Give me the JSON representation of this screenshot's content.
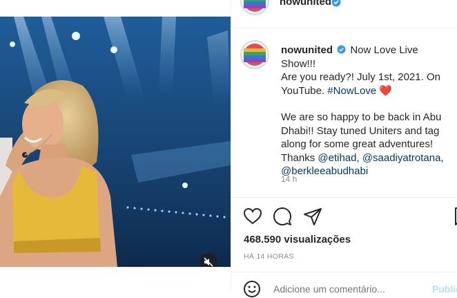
{
  "post": {
    "username": "nowunited",
    "caption_lines": [
      "Now Love Live Show!!!",
      "Are you ready?! July 1st, 2021. On",
      "YouTube."
    ],
    "hashtag": "#NowLove",
    "heart_emoji": "❤️",
    "paragraph2_lines": [
      "We are so happy to be back in Abu",
      "Dhabi!! Stay tuned Uniters and tag",
      "along for some great adventures!"
    ],
    "thanks_text": "Thanks",
    "mentions": [
      "@etihad,",
      "@saadiyatrotana,",
      "@berkleeabudhabi"
    ],
    "caption_time": "14 h",
    "views": "468.590 visualizações",
    "posted_ago": "HÁ 14 HORAS",
    "comment_placeholder": "Adicione um comentário...",
    "publish_label": "Publicar"
  },
  "colors": {
    "verified": "#3897f0",
    "link": "#00376b",
    "heart": "#ed4956",
    "muted": "#8e8e8e",
    "publish": "#b2dffc",
    "stage_blue": "#1b4d80",
    "top_yellow": "#e8b83a"
  },
  "icons": [
    "verified-badge-icon",
    "heart-icon",
    "comment-icon",
    "share-icon",
    "save-icon",
    "mute-icon",
    "emoji-icon"
  ]
}
